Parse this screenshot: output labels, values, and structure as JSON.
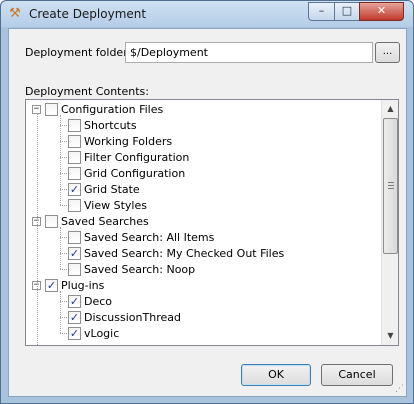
{
  "window": {
    "title": "Create Deployment",
    "app_icon": "tools-icon"
  },
  "caption_buttons": {
    "minimize": "–",
    "maximize": "□",
    "close": "✕"
  },
  "form": {
    "folder_label": "Deployment folder:",
    "folder_value": "$/Deployment",
    "browse_label": "...",
    "contents_label": "Deployment Contents:"
  },
  "tree": {
    "groups": [
      {
        "label": "Configuration Files",
        "expanded": true,
        "checked": false,
        "children": [
          {
            "label": "Shortcuts",
            "checked": false
          },
          {
            "label": "Working Folders",
            "checked": false
          },
          {
            "label": "Filter Configuration",
            "checked": false
          },
          {
            "label": "Grid Configuration",
            "checked": false
          },
          {
            "label": "Grid State",
            "checked": true
          },
          {
            "label": "View Styles",
            "checked": false
          }
        ]
      },
      {
        "label": "Saved Searches",
        "expanded": true,
        "checked": false,
        "children": [
          {
            "label": "Saved Search: All Items",
            "checked": false
          },
          {
            "label": "Saved Search: My Checked Out Files",
            "checked": true
          },
          {
            "label": "Saved Search: Noop",
            "checked": false
          }
        ]
      },
      {
        "label": "Plug-ins",
        "expanded": true,
        "checked": true,
        "children": [
          {
            "label": "Deco",
            "checked": true
          },
          {
            "label": "DiscussionThread",
            "checked": true
          },
          {
            "label": "vLogic",
            "checked": true
          }
        ]
      }
    ],
    "scroll_position": 0.0
  },
  "buttons": {
    "ok": "OK",
    "cancel": "Cancel"
  }
}
